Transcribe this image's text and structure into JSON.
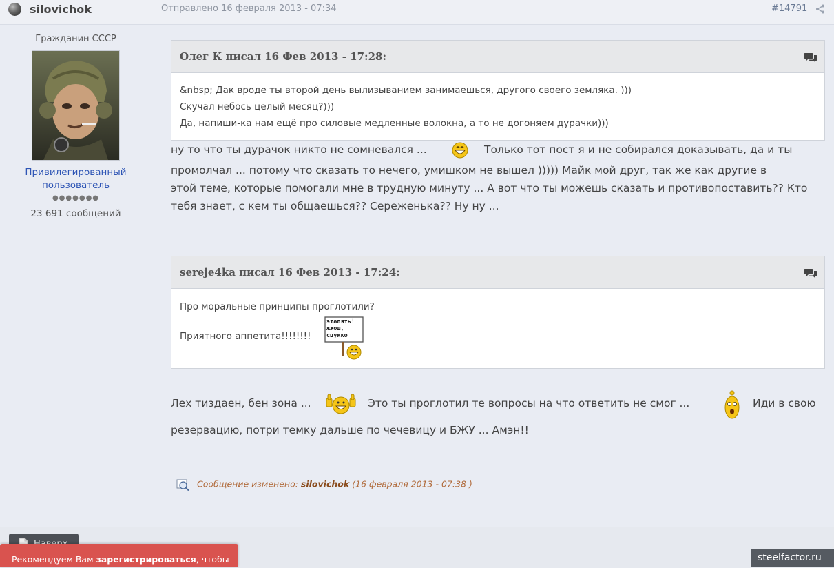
{
  "post": {
    "author": "silovichok",
    "date": "Отправлено 16 февраля 2013 - 07:34",
    "number": "#14791"
  },
  "user": {
    "title": "Гражданин СССР",
    "group_line1": "Привилегированный",
    "group_line2": "пользователь",
    "rank_pips": "●●●●●●●",
    "post_count": "23 691 сообщений"
  },
  "quote1": {
    "cite": "Олег К писал 16 Фев 2013 - 17:28:",
    "lines": [
      "&nbsp; Дак вроде ты второй день вылизыванием занимаешься, другого своего земляка. )))",
      "Скучал небось целый месяц?)))",
      "Да, напиши-ка нам ещё про силовые медленные волокна, а то не догоняем дурачки)))"
    ]
  },
  "reply1": {
    "line1a": "ну то что ты дурачок никто не сомневался ...",
    "line1b": "Только тот пост я и не собирался доказывать, да и ты",
    "line2": "промолчал ... потому что сказать то нечего, умишком не вышел  )))))  Майк мой друг, так же как другие  в",
    "line3": "этой теме, которые помогали мне в трудную минуту ... А вот что ты можешь сказать и противопоставить?? Кто",
    "line4": "тебя знает, с кем ты общаешься?? Сереженька?? Ну ну ..."
  },
  "quote2": {
    "cite": "sereje4ka писал 16 Фев 2013 - 17:24:",
    "line1": "Про моральные принципы проглотили?",
    "line2": "Приятного аппетита!!!!!!!!",
    "sign_text": "этапять! жжош, сцукко"
  },
  "reply2": {
    "part1": "Лех тиздаен, бен зона ...",
    "part2": "Это ты проглотил те вопросы   на что ответить не смог ...",
    "part3": "Иди в свою",
    "line2": "резервацию, потри темку дальше по чечевицу и БЖУ ...  Амэн!!"
  },
  "edit": {
    "prefix": "Сообщение изменено:",
    "user": "silovichok",
    "when": "(16 февраля 2013 - 07:38 )"
  },
  "footer": {
    "back_to_top": "Наверх",
    "register_prefix": "Рекомендуем Вам ",
    "register_link": "зарегистрироваться",
    "register_suffix": ", чтобы",
    "site": "steelfactor.ru"
  }
}
